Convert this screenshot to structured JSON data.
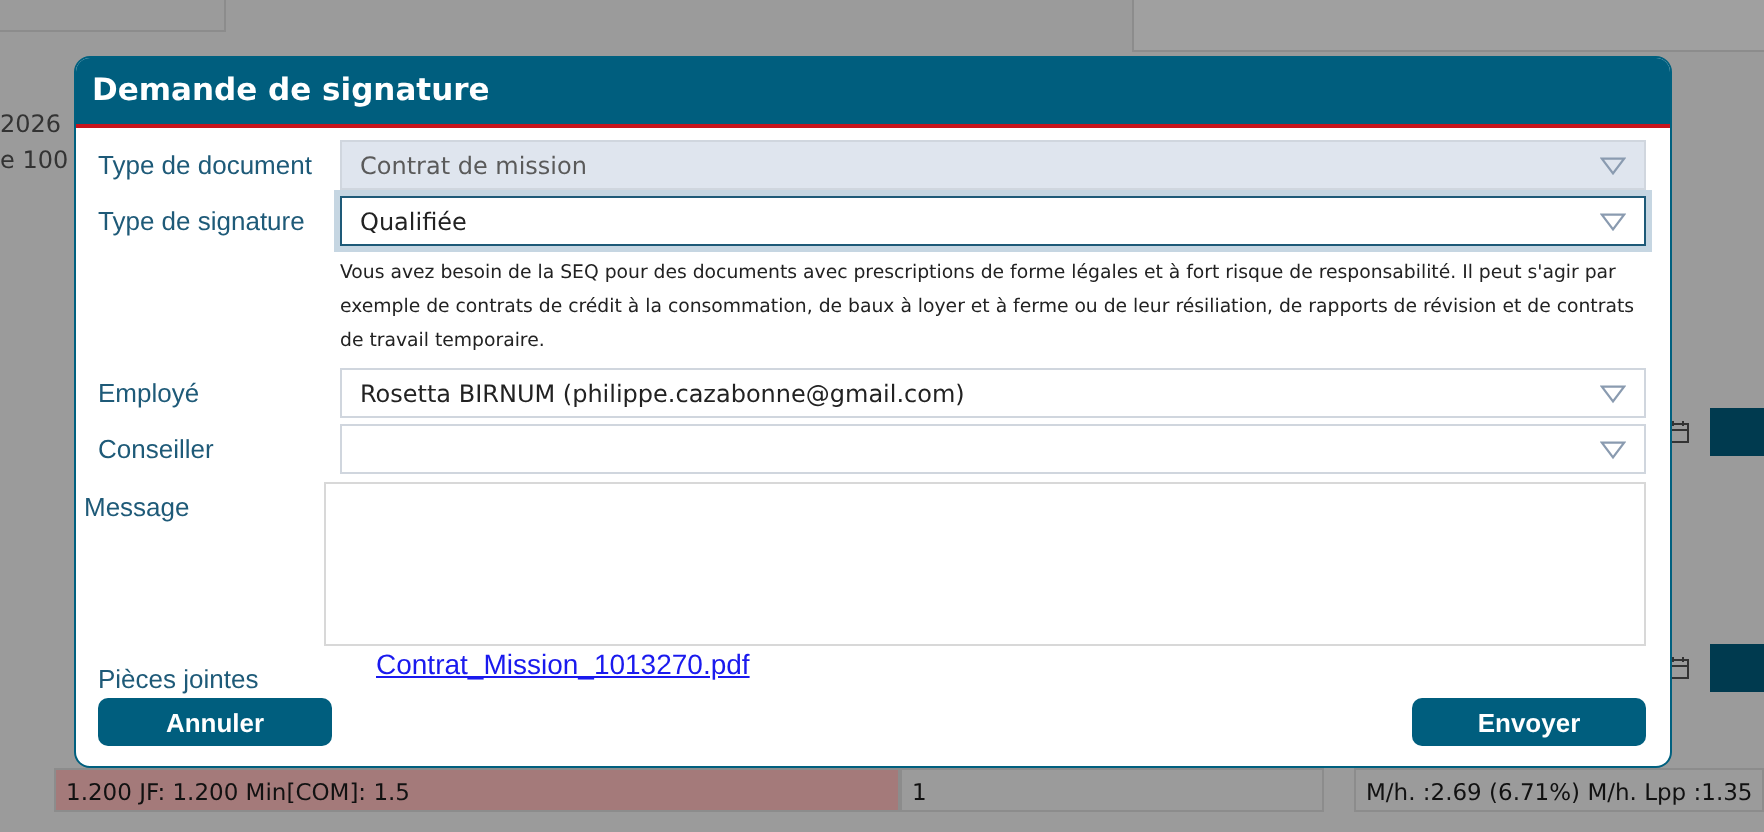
{
  "background": {
    "texts": [
      "2026",
      "e 100"
    ],
    "bottom_row": [
      "1.200 JF: 1.200 Min[COM]: 1.5",
      "1",
      "M/h. :2.69 (6.71%) M/h. Lpp :1.35"
    ]
  },
  "dialog": {
    "title": "Demande de signature",
    "fields": [
      {
        "label": "Type de document",
        "value": "Contrat de mission",
        "disabled": true,
        "focused": false
      },
      {
        "label": "Type de signature",
        "value": "Qualifiée",
        "disabled": false,
        "focused": true,
        "help": "Vous avez besoin de la SEQ pour des documents avec prescriptions de forme légales et à fort risque de responsabilité. Il peut s'agir par exemple de contrats de crédit à la consommation, de baux à loyer et à ferme ou de leur résiliation, de rapports de révision et de contrats de travail temporaire."
      },
      {
        "label": "Employé",
        "value": "Rosetta BIRNUM (philippe.cazabonne@gmail.com)",
        "disabled": false,
        "focused": false
      },
      {
        "label": "Conseiller",
        "disabled": false,
        "focused": false
      }
    ],
    "message": {
      "label": "Message"
    },
    "attachments": {
      "label": "Pièces jointes",
      "files": [
        "Contrat_Mission_1013270.pdf"
      ]
    },
    "buttons": [
      {
        "label": "Annuler"
      },
      {
        "label": "Envoyer"
      }
    ]
  }
}
